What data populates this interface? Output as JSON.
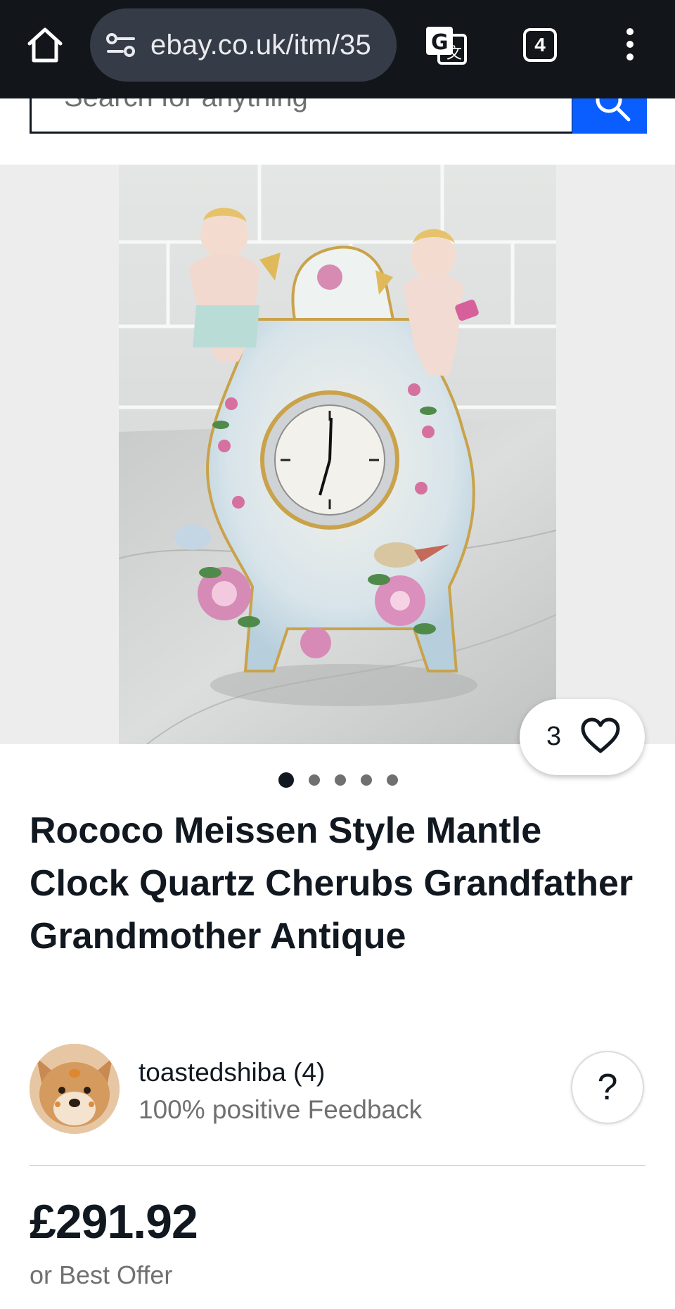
{
  "browser": {
    "url": "ebay.co.uk/itm/35",
    "tab_count": "4"
  },
  "search": {
    "placeholder": "Search for anything"
  },
  "listing": {
    "watch_count": "3",
    "image_count": 5,
    "active_image_index": 0,
    "title": "Rococo Meissen Style Mantle Clock Quartz Cherubs Grandfather Grandmother Antique",
    "seller": {
      "name": "toastedshiba (4)",
      "feedback": "100% positive Feedback"
    },
    "help_label": "?",
    "price": "£291.92",
    "offer_text": "or Best Offer"
  },
  "icons": {
    "home": "home-icon",
    "site_info": "tune-icon",
    "translate": "translate-icon",
    "menu": "more-vert-icon",
    "search": "search-icon",
    "watch": "heart-icon"
  },
  "colors": {
    "browser_bar": "#12161b",
    "url_pill": "#353b47",
    "search_button": "#0a5eff",
    "text_primary": "#111820",
    "text_secondary": "#707070"
  }
}
